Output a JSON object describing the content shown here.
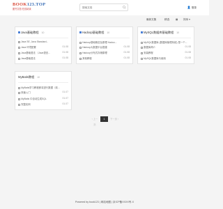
{
  "logo": {
    "main_part1": "BOOK",
    "main_part2": "123.TOP",
    "sub": "图书文档·在线阅读"
  },
  "search": {
    "placeholder": "搜索文档"
  },
  "header": {
    "login": "登录"
  },
  "toolbar": {
    "sort_label": "最新文集",
    "view_label": "精选",
    "grid_label": "▦",
    "filter_label": "排序 ▾"
  },
  "cards": [
    {
      "title": "Java基础教程",
      "count": "10",
      "items": [
        {
          "text": "Java SE, Java Standard...",
          "num": ""
        },
        {
          "text": "Java 环境配置",
          "num": "01.08"
        },
        {
          "text": "Java基础语法 （Java语言...",
          "num": "01.08"
        },
        {
          "text": "Java基础语法",
          "num": "01.08"
        }
      ]
    },
    {
      "title": "Hadoop基础教程",
      "count": "10",
      "items": [
        {
          "text": "Hadoop基础概念及原理 Hadoo...",
          "num": ""
        },
        {
          "text": "Hadoop大数据平台搭建",
          "num": "01.08"
        },
        {
          "text": "Hadoop分布式存储原理",
          "num": "01.08"
        },
        {
          "text": "其他教程",
          "num": "01.08"
        }
      ]
    },
    {
      "title": "MySQL数据库基础教程",
      "count": "10",
      "items": [
        {
          "text": "MySQL数据库 (数据库管理系统) 是一个...",
          "num": ""
        },
        {
          "text": "数据库简介",
          "num": "01.08"
        },
        {
          "text": "安装教程",
          "num": "01.08"
        },
        {
          "text": "MySQL数据库与使用",
          "num": "01.08"
        }
      ]
    },
    {
      "title": "MyBatis教程",
      "count": "10",
      "items": [
        {
          "text": "MyBatis学习教程即将进行数据（前...",
          "num": ""
        },
        {
          "text": "快速入门",
          "num": "01.07"
        },
        {
          "text": "MyBatis 中自动生成SQL",
          "num": "01.07"
        },
        {
          "text": "完整实例",
          "num": "01.07"
        }
      ]
    }
  ],
  "pagination": {
    "prev": "‹ 上一页",
    "current": "1",
    "next": "下一页 ›"
  },
  "footer": {
    "text": "Powered by book123 | 网站地图 | 京ICP备XXXX号-X"
  }
}
